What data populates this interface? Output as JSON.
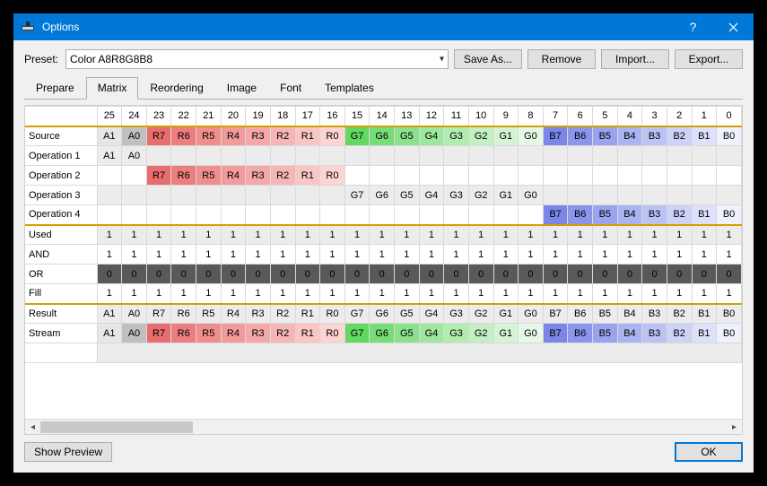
{
  "window": {
    "title": "Options"
  },
  "preset": {
    "label": "Preset:",
    "value": "Color A8R8G8B8",
    "save_as": "Save As...",
    "remove": "Remove",
    "import": "Import...",
    "export": "Export..."
  },
  "tabs": {
    "prepare": "Prepare",
    "matrix": "Matrix",
    "reordering": "Reordering",
    "image": "Image",
    "font": "Font",
    "templates": "Templates"
  },
  "bottom": {
    "show_preview": "Show Preview",
    "ok": "OK"
  },
  "matrix": {
    "cols": [
      "25",
      "24",
      "23",
      "22",
      "21",
      "20",
      "19",
      "18",
      "17",
      "16",
      "15",
      "14",
      "13",
      "12",
      "11",
      "10",
      "9",
      "8",
      "7",
      "6",
      "5",
      "4",
      "3",
      "2",
      "1",
      "0"
    ],
    "rows": [
      {
        "label": "Source",
        "sep": true,
        "cells": [
          {
            "t": "A1",
            "c": "cA-lt"
          },
          {
            "t": "A0",
            "c": "cA"
          },
          {
            "t": "R7",
            "c": "cR7"
          },
          {
            "t": "R6",
            "c": "cR6"
          },
          {
            "t": "R5",
            "c": "cR5"
          },
          {
            "t": "R4",
            "c": "cR4"
          },
          {
            "t": "R3",
            "c": "cR3"
          },
          {
            "t": "R2",
            "c": "cR2"
          },
          {
            "t": "R1",
            "c": "cR1"
          },
          {
            "t": "R0",
            "c": "cR0"
          },
          {
            "t": "G7",
            "c": "cG7"
          },
          {
            "t": "G6",
            "c": "cG6"
          },
          {
            "t": "G5",
            "c": "cG5"
          },
          {
            "t": "G4",
            "c": "cG4"
          },
          {
            "t": "G3",
            "c": "cG3"
          },
          {
            "t": "G2",
            "c": "cG2"
          },
          {
            "t": "G1",
            "c": "cG1"
          },
          {
            "t": "G0",
            "c": "cG0"
          },
          {
            "t": "B7",
            "c": "cB7"
          },
          {
            "t": "B6",
            "c": "cB6"
          },
          {
            "t": "B5",
            "c": "cB5"
          },
          {
            "t": "B4",
            "c": "cB4"
          },
          {
            "t": "B3",
            "c": "cB3"
          },
          {
            "t": "B2",
            "c": "cB2"
          },
          {
            "t": "B1",
            "c": "cB1"
          },
          {
            "t": "B0",
            "c": "cB0"
          }
        ]
      },
      {
        "label": "Operation 1",
        "gray": true,
        "cells": [
          {
            "t": "A1",
            "c": "cA-lt"
          },
          {
            "t": "A0",
            "c": "cA"
          },
          {
            "t": ""
          },
          {
            "t": ""
          },
          {
            "t": ""
          },
          {
            "t": ""
          },
          {
            "t": ""
          },
          {
            "t": ""
          },
          {
            "t": ""
          },
          {
            "t": ""
          },
          {
            "t": ""
          },
          {
            "t": ""
          },
          {
            "t": ""
          },
          {
            "t": ""
          },
          {
            "t": ""
          },
          {
            "t": ""
          },
          {
            "t": ""
          },
          {
            "t": ""
          },
          {
            "t": ""
          },
          {
            "t": ""
          },
          {
            "t": ""
          },
          {
            "t": ""
          },
          {
            "t": ""
          },
          {
            "t": ""
          },
          {
            "t": ""
          },
          {
            "t": ""
          }
        ]
      },
      {
        "label": "Operation 2",
        "cells": [
          {
            "t": ""
          },
          {
            "t": ""
          },
          {
            "t": "R7",
            "c": "cR7"
          },
          {
            "t": "R6",
            "c": "cR6"
          },
          {
            "t": "R5",
            "c": "cR5"
          },
          {
            "t": "R4",
            "c": "cR4"
          },
          {
            "t": "R3",
            "c": "cR3"
          },
          {
            "t": "R2",
            "c": "cR2"
          },
          {
            "t": "R1",
            "c": "cR1"
          },
          {
            "t": "R0",
            "c": "cR0"
          },
          {
            "t": ""
          },
          {
            "t": ""
          },
          {
            "t": ""
          },
          {
            "t": ""
          },
          {
            "t": ""
          },
          {
            "t": ""
          },
          {
            "t": ""
          },
          {
            "t": ""
          },
          {
            "t": ""
          },
          {
            "t": ""
          },
          {
            "t": ""
          },
          {
            "t": ""
          },
          {
            "t": ""
          },
          {
            "t": ""
          },
          {
            "t": ""
          },
          {
            "t": ""
          }
        ]
      },
      {
        "label": "Operation 3",
        "gray": true,
        "cells": [
          {
            "t": ""
          },
          {
            "t": ""
          },
          {
            "t": ""
          },
          {
            "t": ""
          },
          {
            "t": ""
          },
          {
            "t": ""
          },
          {
            "t": ""
          },
          {
            "t": ""
          },
          {
            "t": ""
          },
          {
            "t": ""
          },
          {
            "t": "G7",
            "c": "cG7"
          },
          {
            "t": "G6",
            "c": "cG6"
          },
          {
            "t": "G5",
            "c": "cG5"
          },
          {
            "t": "G4",
            "c": "cG4"
          },
          {
            "t": "G3",
            "c": "cG3"
          },
          {
            "t": "G2",
            "c": "cG2"
          },
          {
            "t": "G1",
            "c": "cG1"
          },
          {
            "t": "G0",
            "c": "cG0"
          },
          {
            "t": ""
          },
          {
            "t": ""
          },
          {
            "t": ""
          },
          {
            "t": ""
          },
          {
            "t": ""
          },
          {
            "t": ""
          },
          {
            "t": ""
          },
          {
            "t": ""
          }
        ]
      },
      {
        "label": "Operation 4",
        "cells": [
          {
            "t": ""
          },
          {
            "t": ""
          },
          {
            "t": ""
          },
          {
            "t": ""
          },
          {
            "t": ""
          },
          {
            "t": ""
          },
          {
            "t": ""
          },
          {
            "t": ""
          },
          {
            "t": ""
          },
          {
            "t": ""
          },
          {
            "t": ""
          },
          {
            "t": ""
          },
          {
            "t": ""
          },
          {
            "t": ""
          },
          {
            "t": ""
          },
          {
            "t": ""
          },
          {
            "t": ""
          },
          {
            "t": ""
          },
          {
            "t": "B7",
            "c": "cB7"
          },
          {
            "t": "B6",
            "c": "cB6"
          },
          {
            "t": "B5",
            "c": "cB5"
          },
          {
            "t": "B4",
            "c": "cB4"
          },
          {
            "t": "B3",
            "c": "cB3"
          },
          {
            "t": "B2",
            "c": "cB2"
          },
          {
            "t": "B1",
            "c": "cB1"
          },
          {
            "t": "B0",
            "c": "cB0"
          }
        ]
      },
      {
        "label": "Used",
        "gray": true,
        "sep": true,
        "fill": "1"
      },
      {
        "label": "AND",
        "fill": "1"
      },
      {
        "label": "OR",
        "dark": true,
        "fill": "0"
      },
      {
        "label": "Fill",
        "fill": "1"
      },
      {
        "label": "Result",
        "gray": true,
        "sep": true,
        "cells": [
          {
            "t": "A1",
            "c": "cA-lt"
          },
          {
            "t": "A0",
            "c": "cA"
          },
          {
            "t": "R7",
            "c": "cR7"
          },
          {
            "t": "R6",
            "c": "cR6"
          },
          {
            "t": "R5",
            "c": "cR5"
          },
          {
            "t": "R4",
            "c": "cR4"
          },
          {
            "t": "R3",
            "c": "cR3"
          },
          {
            "t": "R2",
            "c": "cR2"
          },
          {
            "t": "R1",
            "c": "cR1"
          },
          {
            "t": "R0",
            "c": "cR0"
          },
          {
            "t": "G7",
            "c": "cG7"
          },
          {
            "t": "G6",
            "c": "cG6"
          },
          {
            "t": "G5",
            "c": "cG5"
          },
          {
            "t": "G4",
            "c": "cG4"
          },
          {
            "t": "G3",
            "c": "cG3"
          },
          {
            "t": "G2",
            "c": "cG2"
          },
          {
            "t": "G1",
            "c": "cG1"
          },
          {
            "t": "G0",
            "c": "cG0"
          },
          {
            "t": "B7",
            "c": "cB7"
          },
          {
            "t": "B6",
            "c": "cB6"
          },
          {
            "t": "B5",
            "c": "cB5"
          },
          {
            "t": "B4",
            "c": "cB4"
          },
          {
            "t": "B3",
            "c": "cB3"
          },
          {
            "t": "B2",
            "c": "cB2"
          },
          {
            "t": "B1",
            "c": "cB1"
          },
          {
            "t": "B0",
            "c": "cB0"
          }
        ]
      },
      {
        "label": "Stream",
        "cells": [
          {
            "t": "A1",
            "c": "cA-lt"
          },
          {
            "t": "A0",
            "c": "cA"
          },
          {
            "t": "R7",
            "c": "cR7"
          },
          {
            "t": "R6",
            "c": "cR6"
          },
          {
            "t": "R5",
            "c": "cR5"
          },
          {
            "t": "R4",
            "c": "cR4"
          },
          {
            "t": "R3",
            "c": "cR3"
          },
          {
            "t": "R2",
            "c": "cR2"
          },
          {
            "t": "R1",
            "c": "cR1"
          },
          {
            "t": "R0",
            "c": "cR0"
          },
          {
            "t": "G7",
            "c": "cG7"
          },
          {
            "t": "G6",
            "c": "cG6"
          },
          {
            "t": "G5",
            "c": "cG5"
          },
          {
            "t": "G4",
            "c": "cG4"
          },
          {
            "t": "G3",
            "c": "cG3"
          },
          {
            "t": "G2",
            "c": "cG2"
          },
          {
            "t": "G1",
            "c": "cG1"
          },
          {
            "t": "G0",
            "c": "cG0"
          },
          {
            "t": "B7",
            "c": "cB7"
          },
          {
            "t": "B6",
            "c": "cB6"
          },
          {
            "t": "B5",
            "c": "cB5"
          },
          {
            "t": "B4",
            "c": "cB4"
          },
          {
            "t": "B3",
            "c": "cB3"
          },
          {
            "t": "B2",
            "c": "cB2"
          },
          {
            "t": "B1",
            "c": "cB1"
          },
          {
            "t": "B0",
            "c": "cB0"
          }
        ]
      }
    ]
  }
}
